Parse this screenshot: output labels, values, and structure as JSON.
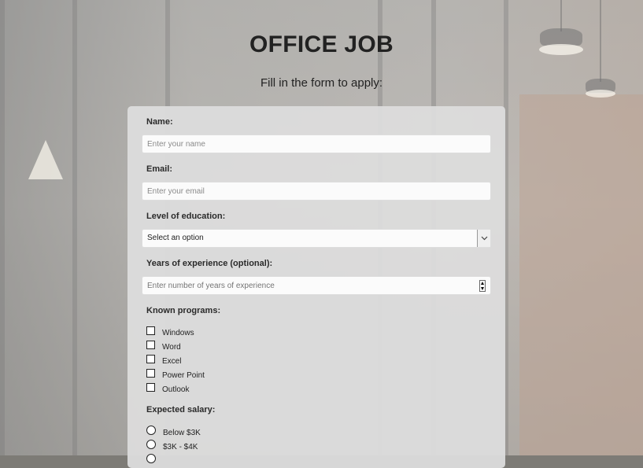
{
  "header": {
    "title": "OFFICE JOB",
    "subtitle": "Fill in the form to apply:"
  },
  "form": {
    "name": {
      "label": "Name:",
      "placeholder": "Enter your name"
    },
    "email": {
      "label": "Email:",
      "placeholder": "Enter your email"
    },
    "education": {
      "label": "Level of education:",
      "selected": "Select an option"
    },
    "experience": {
      "label": "Years of experience (optional):",
      "placeholder": "Enter number of years of experience"
    },
    "programs": {
      "label": "Known programs:",
      "options": [
        "Windows",
        "Word",
        "Excel",
        "Power Point",
        "Outlook"
      ]
    },
    "salary": {
      "label": "Expected salary:",
      "options": [
        "Below $3K",
        "$3K - $4K"
      ]
    }
  },
  "icons": {
    "select": "chevron-down-icon",
    "number": "spinner-icon",
    "checkbox": "checkbox-icon",
    "radio": "radio-icon"
  },
  "colors": {
    "card": "#dcdcdc",
    "title": "#222222",
    "input_bg": "#fbfbfb"
  }
}
